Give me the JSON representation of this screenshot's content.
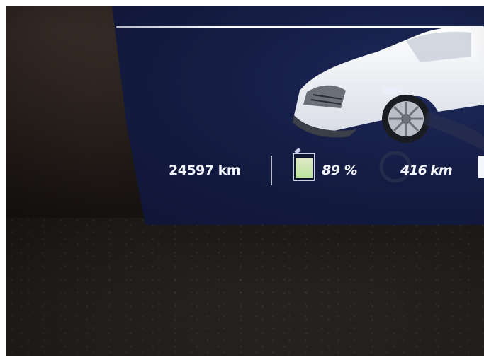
{
  "cluster": {
    "odometer": "24597 km",
    "battery_charge": "89 %",
    "battery_level": 0.89,
    "range": "416 km"
  },
  "icons": {
    "battery": "battery-icon",
    "car": "car-icon"
  },
  "colors": {
    "screen_background": "#151d45",
    "text": "#f4f6ff",
    "battery_fill": "#b9e39a"
  }
}
